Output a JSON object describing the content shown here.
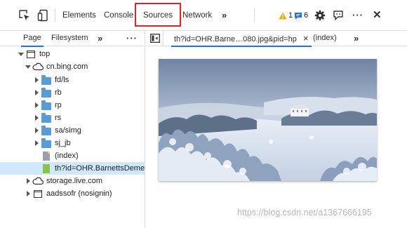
{
  "toolbar": {
    "tabs": [
      "Elements",
      "Console",
      "Sources",
      "Network"
    ],
    "more_label": "»",
    "warning_count": "1",
    "message_count": "6",
    "menu_label": "···",
    "close_label": "✕"
  },
  "navigator": {
    "tabs": [
      "Page",
      "Filesystem"
    ],
    "more_label": "»",
    "menu_label": "···",
    "tree": [
      {
        "label": "top",
        "kind": "frame",
        "expanded": true
      },
      {
        "label": "cn.bing.com",
        "kind": "cloud",
        "expanded": true
      },
      {
        "label": "fd/ls",
        "kind": "folder"
      },
      {
        "label": "rb",
        "kind": "folder"
      },
      {
        "label": "rp",
        "kind": "folder"
      },
      {
        "label": "rs",
        "kind": "folder"
      },
      {
        "label": "sa/simg",
        "kind": "folder"
      },
      {
        "label": "sj_jb",
        "kind": "folder"
      },
      {
        "label": "(index)",
        "kind": "file"
      },
      {
        "label": "th?id=OHR.BarnettsDemesr",
        "kind": "image-file",
        "selected": true
      },
      {
        "label": "storage.live.com",
        "kind": "cloud"
      },
      {
        "label": "aadssofr (nosignin)",
        "kind": "frame"
      }
    ]
  },
  "editor": {
    "active_tab": "th?id=OHR.Barne…080.jpg&pid=hp",
    "close_label": "×",
    "second_tab": "(index)",
    "more_label": "»"
  },
  "watermark": "https://blog.csdn.net/a1367666195",
  "colors": {
    "accent": "#1a73e8",
    "highlight_box": "#e02424",
    "selected_row": "#cfe8fc",
    "folder": "#5b9bd5"
  }
}
